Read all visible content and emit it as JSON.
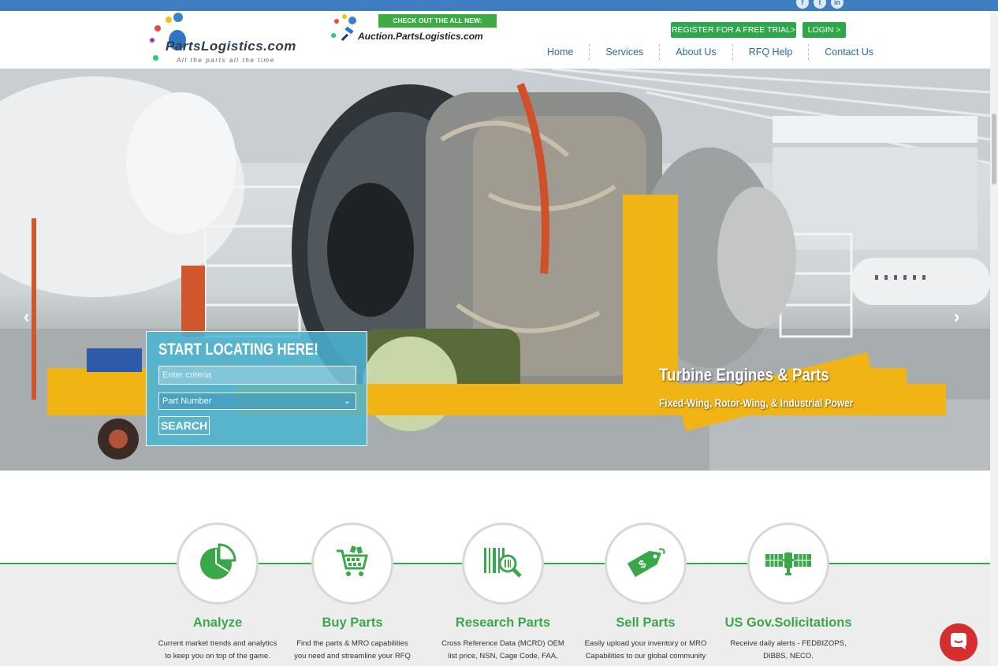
{
  "social": [
    "f",
    "t",
    "in"
  ],
  "logo": {
    "text": "PartsLogistics.com",
    "tagline": "All the parts all the time"
  },
  "auction": {
    "banner": "CHECK OUT THE ALL NEW:",
    "text": "Auction.PartsLogistics.com"
  },
  "header": {
    "register_label": "REGISTER FOR A FREE TRIAL>",
    "login_label": "LOGIN >"
  },
  "nav": [
    "Home",
    "Services",
    "About Us",
    "RFQ Help",
    "Contact Us"
  ],
  "hero": {
    "prev_arrow": "‹",
    "next_arrow": "›",
    "caption_title": "Turbine Engines & Parts",
    "caption_sub": "Fixed-Wing, Rotor-Wing, & Industrial Power"
  },
  "search": {
    "title": "START LOCATING HERE!",
    "placeholder": "Enter criteria",
    "select_value": "Part Number",
    "button_label": "SEARCH"
  },
  "services": [
    {
      "title": "Analyze",
      "desc1": "Current market trends and analytics",
      "desc2": "to keep you on top of the game.",
      "icon": "pie-chart-icon"
    },
    {
      "title": "Buy Parts",
      "desc1": "Find the parts & MRO capabilities",
      "desc2": "you need and streamline your RFQ",
      "icon": "shopping-cart-icon"
    },
    {
      "title": "Research Parts",
      "desc1": "Cross Reference Data (MCRD) OEM",
      "desc2": "list price, NSN, Cage Code, FAA,",
      "icon": "barcode-search-icon"
    },
    {
      "title": "Sell Parts",
      "desc1": "Easily upload your inventory or MRO",
      "desc2": "Capabilities to our global community",
      "icon": "price-tag-icon"
    },
    {
      "title": "US Gov.Solicitations",
      "desc1": "Receive daily alerts - FEDBIZOPS,",
      "desc2": "DIBBS, NECO.",
      "icon": "satellite-icon"
    }
  ],
  "colors": {
    "accent_green": "#3aa84a",
    "top_bar_blue": "#3f7fc0",
    "nav_blue": "#2b6aa8",
    "chat_red": "#d42e2e"
  }
}
